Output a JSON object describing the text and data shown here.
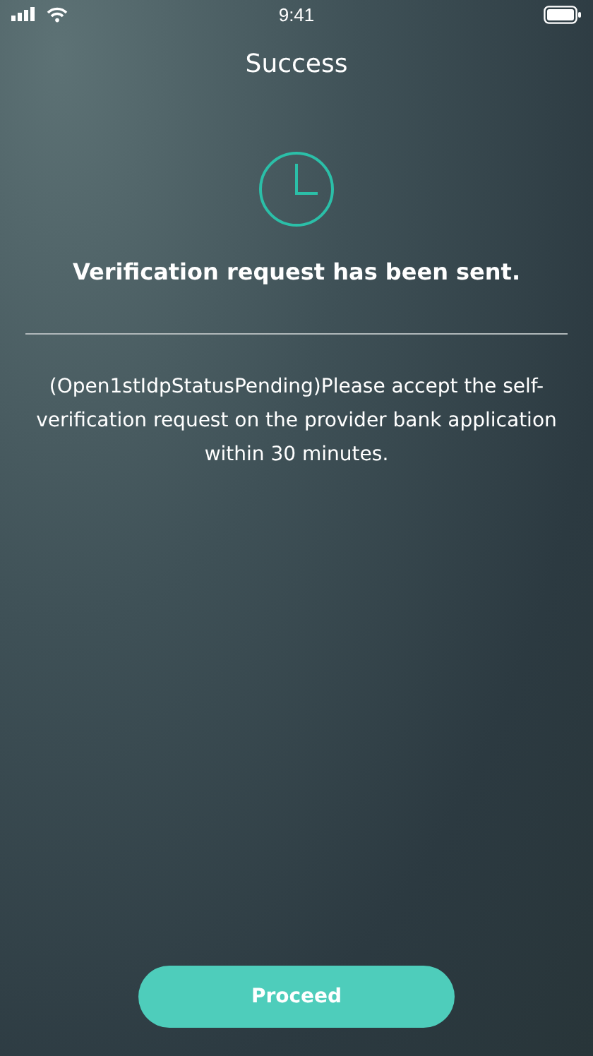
{
  "status_bar": {
    "time": "9:41"
  },
  "header": {
    "title": "Success"
  },
  "message": {
    "heading": "Verification request has been sent.",
    "body": "(Open1stIdpStatusPending)Please accept the self-verification request on the provider bank application within 30 minutes."
  },
  "buttons": [
    {
      "label": "Proceed"
    }
  ]
}
